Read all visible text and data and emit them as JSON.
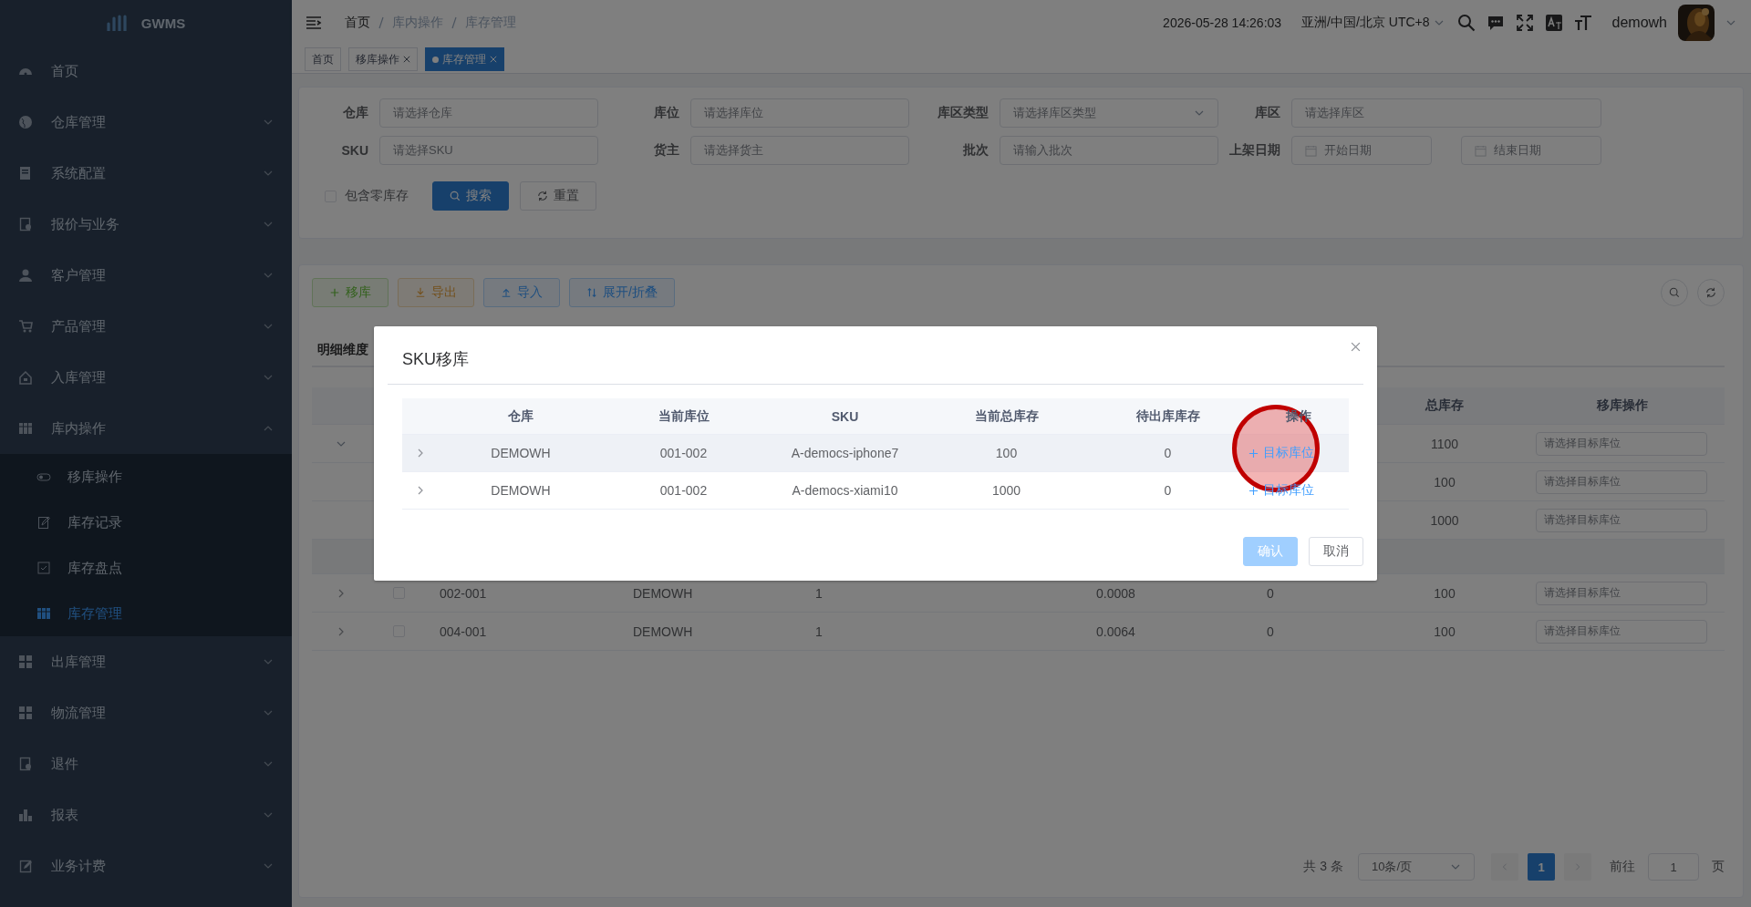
{
  "sidebar": {
    "logo": "GWMS",
    "items": [
      {
        "label": "首页",
        "kind": "link"
      },
      {
        "label": "仓库管理",
        "kind": "submenu",
        "expanded": false
      },
      {
        "label": "系统配置",
        "kind": "submenu",
        "expanded": false
      },
      {
        "label": "报价与业务",
        "kind": "submenu",
        "expanded": false
      },
      {
        "label": "客户管理",
        "kind": "submenu",
        "expanded": false
      },
      {
        "label": "产品管理",
        "kind": "submenu",
        "expanded": false
      },
      {
        "label": "入库管理",
        "kind": "submenu",
        "expanded": false
      },
      {
        "label": "库内操作",
        "kind": "submenu",
        "expanded": true,
        "children": [
          {
            "label": "移库操作",
            "selected": false
          },
          {
            "label": "库存记录",
            "selected": false
          },
          {
            "label": "库存盘点",
            "selected": false
          },
          {
            "label": "库存管理",
            "selected": true
          }
        ]
      },
      {
        "label": "出库管理",
        "kind": "submenu",
        "expanded": false
      },
      {
        "label": "物流管理",
        "kind": "submenu",
        "expanded": false
      },
      {
        "label": "退件",
        "kind": "submenu",
        "expanded": false
      },
      {
        "label": "报表",
        "kind": "submenu",
        "expanded": false
      },
      {
        "label": "业务计费",
        "kind": "submenu",
        "expanded": false
      }
    ]
  },
  "header": {
    "breadcrumb": [
      "首页",
      "库内操作",
      "库存管理"
    ],
    "datetime": "2026-05-28 14:26:03",
    "timezone": "亚洲/中国/北京 UTC+8",
    "user": "demowh"
  },
  "tags": [
    {
      "label": "首页",
      "closable": false,
      "selected": false
    },
    {
      "label": "移库操作",
      "closable": true,
      "selected": false
    },
    {
      "label": "库存管理",
      "closable": true,
      "selected": true
    }
  ],
  "filters": [
    {
      "label": "仓库",
      "kind": "input",
      "placeholder": "请选择仓库"
    },
    {
      "label": "库位",
      "kind": "input",
      "placeholder": "请选择库位"
    },
    {
      "label": "库区类型",
      "kind": "select",
      "placeholder": "请选择库区类型"
    },
    {
      "label": "库区",
      "kind": "input",
      "placeholder": "请选择库区"
    },
    {
      "label": "SKU",
      "kind": "input",
      "placeholder": "请选择SKU"
    },
    {
      "label": "货主",
      "kind": "input",
      "placeholder": "请选择货主"
    },
    {
      "label": "批次",
      "kind": "input",
      "placeholder": "请输入批次"
    },
    {
      "label": "上架日期",
      "kind": "daterange",
      "placeholders": [
        "开始日期",
        "结束日期"
      ]
    }
  ],
  "include_zero": {
    "label": "包含零库存",
    "checked": false
  },
  "filter_buttons": [
    {
      "label": "搜索",
      "kind": "primary"
    },
    {
      "label": "重置",
      "kind": "default"
    }
  ],
  "toolbar": [
    {
      "label": "移库",
      "kind": "success"
    },
    {
      "label": "导出",
      "kind": "warning"
    },
    {
      "label": "导入",
      "kind": "primary"
    },
    {
      "label": "展开/折叠",
      "kind": "info"
    }
  ],
  "view_tab": "明细维度",
  "table": {
    "header_total": "总库存",
    "header_action": "移库操作",
    "rows": [
      {
        "kind": "group",
        "expanded": true,
        "total": "1100",
        "target_placeholder": "请选择目标库位"
      },
      {
        "kind": "child",
        "total": "100",
        "target_placeholder": "请选择目标库位"
      },
      {
        "kind": "child",
        "total": "1000",
        "target_placeholder": "请选择目标库位"
      },
      {
        "kind": "band"
      },
      {
        "kind": "item",
        "expanded": false,
        "checked": false,
        "location": "002-001",
        "warehouse": "DEMOWH",
        "column_5": "1",
        "column_6": "0.0008",
        "column_7": "0",
        "total": "100",
        "target_placeholder": "请选择目标库位"
      },
      {
        "kind": "item",
        "expanded": false,
        "checked": false,
        "location": "004-001",
        "warehouse": "DEMOWH",
        "column_5": "1",
        "column_6": "0.0064",
        "column_7": "0",
        "total": "100",
        "target_placeholder": "请选择目标库位"
      }
    ]
  },
  "pagination": {
    "total": "共 3 条",
    "page_size": "10条/页",
    "pages": [
      {
        "label": "1",
        "selected": true
      }
    ],
    "goto_label": "前往",
    "goto_value": "1",
    "page_suffix": "页"
  },
  "dialog": {
    "title": "SKU移库",
    "columns": [
      "仓库",
      "当前库位",
      "SKU",
      "当前总库存",
      "待出库库存",
      "操作"
    ],
    "rows": [
      {
        "hovered": true,
        "cells": [
          "DEMOWH",
          "001-002",
          "A-democs-iphone7",
          "100",
          "0"
        ],
        "action": "目标库位"
      },
      {
        "hovered": false,
        "cells": [
          "DEMOWH",
          "001-002",
          "A-democs-xiami10",
          "1000",
          "0"
        ],
        "action": "目标库位"
      }
    ],
    "buttons": [
      {
        "label": "确认",
        "kind": "primary",
        "disabled": true
      },
      {
        "label": "取消",
        "kind": "default",
        "disabled": false
      }
    ]
  },
  "click_marker": {
    "visible": true
  }
}
